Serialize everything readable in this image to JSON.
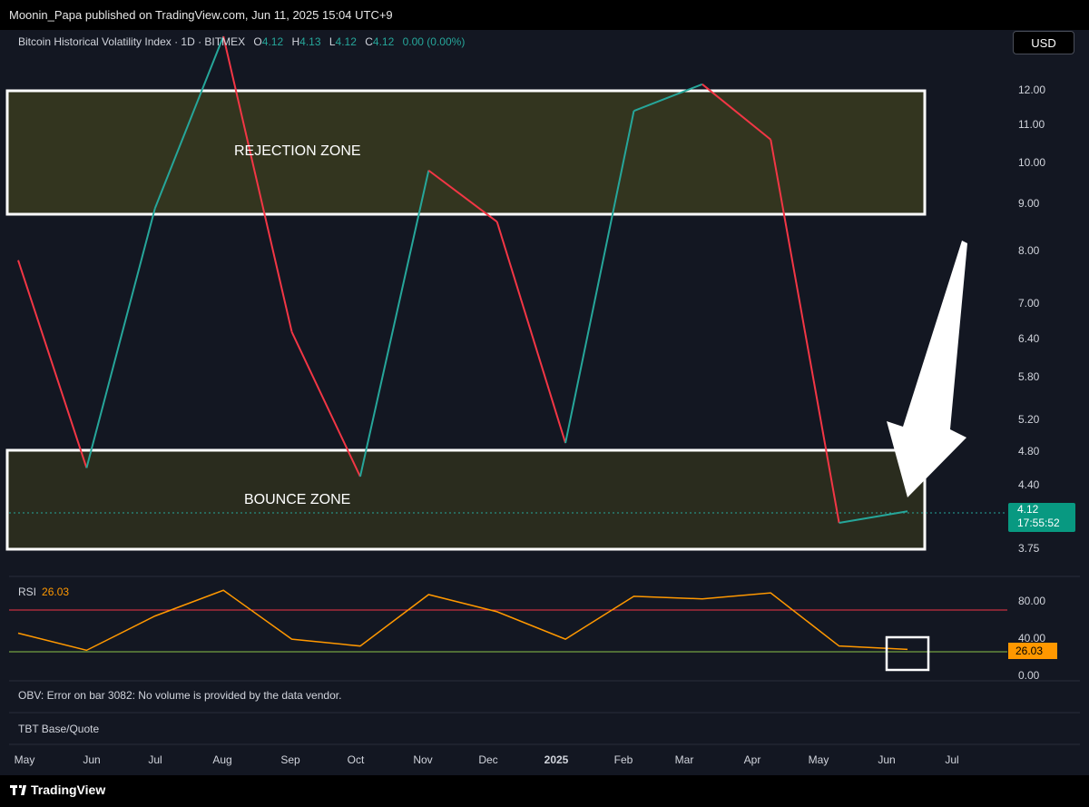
{
  "header": {
    "publish_text": "Moonin_Papa published on TradingView.com, Jun 11, 2025 15:04 UTC+9"
  },
  "legend": {
    "symbol": "Bitcoin Historical Volatility Index · 1D · BITMEX",
    "o_label": "O",
    "o_value": "4.12",
    "h_label": "H",
    "h_value": "4.13",
    "l_label": "L",
    "l_value": "4.12",
    "c_label": "C",
    "c_value": "4.12",
    "change": "0.00 (0.00%)"
  },
  "currency_button": "USD",
  "price_axis": [
    "12.00",
    "11.00",
    "10.00",
    "9.00",
    "8.00",
    "7.00",
    "6.40",
    "5.80",
    "5.20",
    "4.80",
    "4.40",
    "3.75"
  ],
  "last_price": {
    "value": "4.12",
    "countdown": "17:55:52"
  },
  "annotations": {
    "rejection_zone": "REJECTION ZONE",
    "bounce_zone": "BOUNCE ZONE"
  },
  "rsi": {
    "label": "RSI",
    "value": "26.03",
    "axis": [
      "80.00",
      "40.00",
      "0.00"
    ]
  },
  "obv_text": "OBV: Error on bar 3082: No volume is provided by the data vendor.",
  "tbt_text": "TBT Base/Quote",
  "time_axis": [
    "May",
    "Jun",
    "Jul",
    "Aug",
    "Sep",
    "Oct",
    "Nov",
    "Dec",
    "2025",
    "Feb",
    "Mar",
    "Apr",
    "May",
    "Jun",
    "Jul"
  ],
  "footer": {
    "brand": "TradingView"
  },
  "colors": {
    "up": "#26a69a",
    "down": "#f23645",
    "rsi_line": "#ff9800",
    "overbought": "#f23645",
    "oversold": "#4caf50",
    "zone_fill": "#33351f"
  },
  "chart_data": [
    {
      "type": "line",
      "title": "Bitcoin Historical Volatility Index · 1D · BITMEX",
      "x": [
        "2024-05",
        "2024-06",
        "2024-07",
        "2024-08",
        "2024-09",
        "2024-10",
        "2024-11",
        "2024-12",
        "2025-01",
        "2025-02",
        "2025-03",
        "2025-04",
        "2025-05",
        "2025-06"
      ],
      "series": [
        {
          "name": "",
          "values": [
            7.8,
            4.6,
            8.9,
            14.0,
            6.5,
            4.5,
            9.8,
            8.6,
            4.9,
            11.4,
            12.2,
            10.6,
            4.0,
            4.12
          ]
        }
      ],
      "ylim": [
        3.6,
        12.6
      ],
      "scale": "log"
    },
    {
      "type": "line",
      "title": "RSI",
      "series": [
        {
          "name": "",
          "values": [
            45,
            25,
            65,
            95,
            38,
            30,
            90,
            70,
            38,
            88,
            85,
            92,
            30,
            26.03
          ]
        }
      ],
      "ylim": [
        0,
        100
      ],
      "levels": [
        70,
        30
      ]
    }
  ]
}
